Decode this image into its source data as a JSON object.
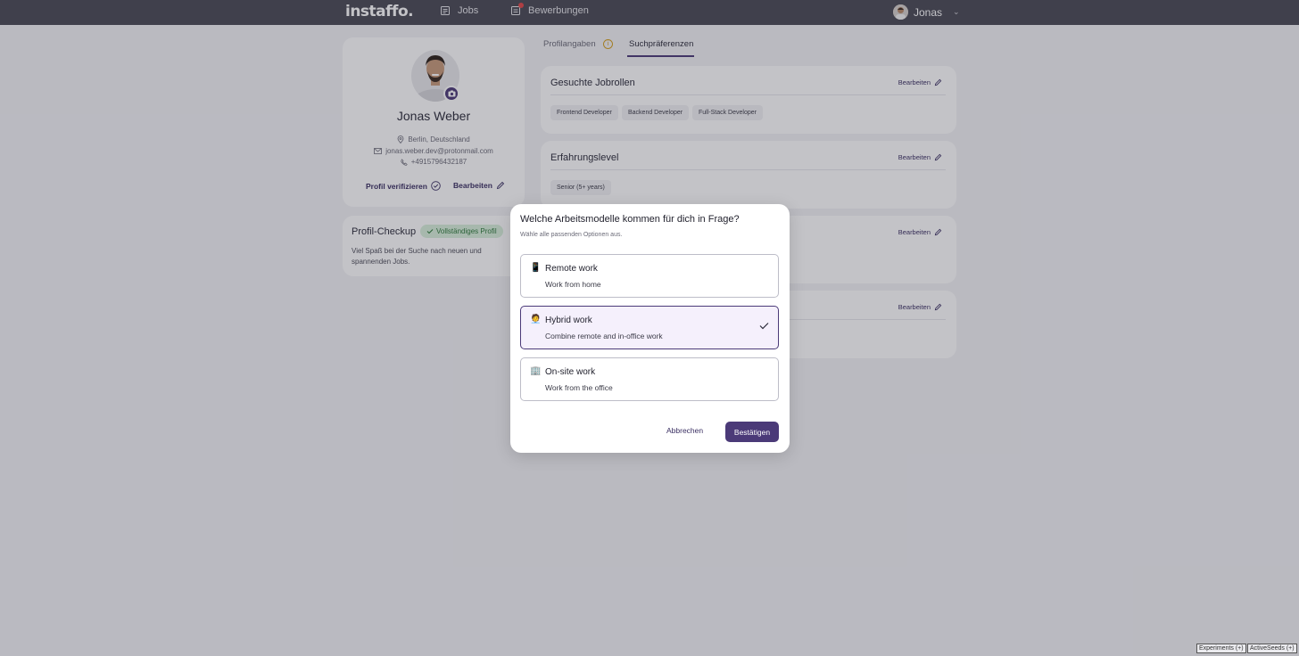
{
  "nav": {
    "logo": "instaffo.",
    "jobs_label": "Jobs",
    "applications_label": "Bewerbungen",
    "user_name": "Jonas"
  },
  "profile": {
    "name": "Jonas Weber",
    "location": "Berlin, Deutschland",
    "email": "jonas.weber.dev@protonmail.com",
    "phone": "+4915796432187",
    "verify_label": "Profil verifizieren",
    "edit_label": "Bearbeiten"
  },
  "checkup": {
    "title": "Profil-Checkup",
    "badge": "Vollständiges Profil",
    "text": "Viel Spaß bei der Suche nach neuen und spannenden Jobs."
  },
  "tabs": [
    {
      "label": "Profilangaben"
    },
    {
      "label": "Suchpräferenzen"
    }
  ],
  "sections": [
    {
      "title": "Gesuchte Jobrollen",
      "edit": "Bearbeiten",
      "chips": [
        "Frontend Developer",
        "Backend Developer",
        "Full-Stack Developer"
      ]
    },
    {
      "title": "Erfahrungslevel",
      "edit": "Bearbeiten",
      "chips": [
        "Senior (5+ years)"
      ]
    },
    {
      "title": "",
      "edit": "Bearbeiten",
      "chips": []
    },
    {
      "title": "",
      "edit": "Bearbeiten",
      "chips": []
    }
  ],
  "modal": {
    "title": "Welche Arbeitsmodelle kommen für dich in Frage?",
    "subtitle": "Wähle alle passenden Optionen aus.",
    "options": [
      {
        "icon": "phone-icon",
        "emoji": "📱",
        "title": "Remote work",
        "desc": "Work from home",
        "selected": false
      },
      {
        "icon": "person-icon",
        "emoji": "🧑‍💼",
        "title": "Hybrid work",
        "desc": "Combine remote and in-office work",
        "selected": true
      },
      {
        "icon": "building-icon",
        "emoji": "🏢",
        "title": "On-site work",
        "desc": "Work from the office",
        "selected": false
      }
    ],
    "cancel_label": "Abbrechen",
    "confirm_label": "Bestätigen"
  },
  "debug": {
    "experiments": "Experiments (+)",
    "active_seeds": "ActiveSeeds (+)"
  },
  "colors": {
    "accent": "#4b3a78",
    "nav_bg": "#4a4a55",
    "success_bg": "#d9f0dc",
    "success_text": "#2d7a3a",
    "selected_bg": "#f5f0fc"
  }
}
